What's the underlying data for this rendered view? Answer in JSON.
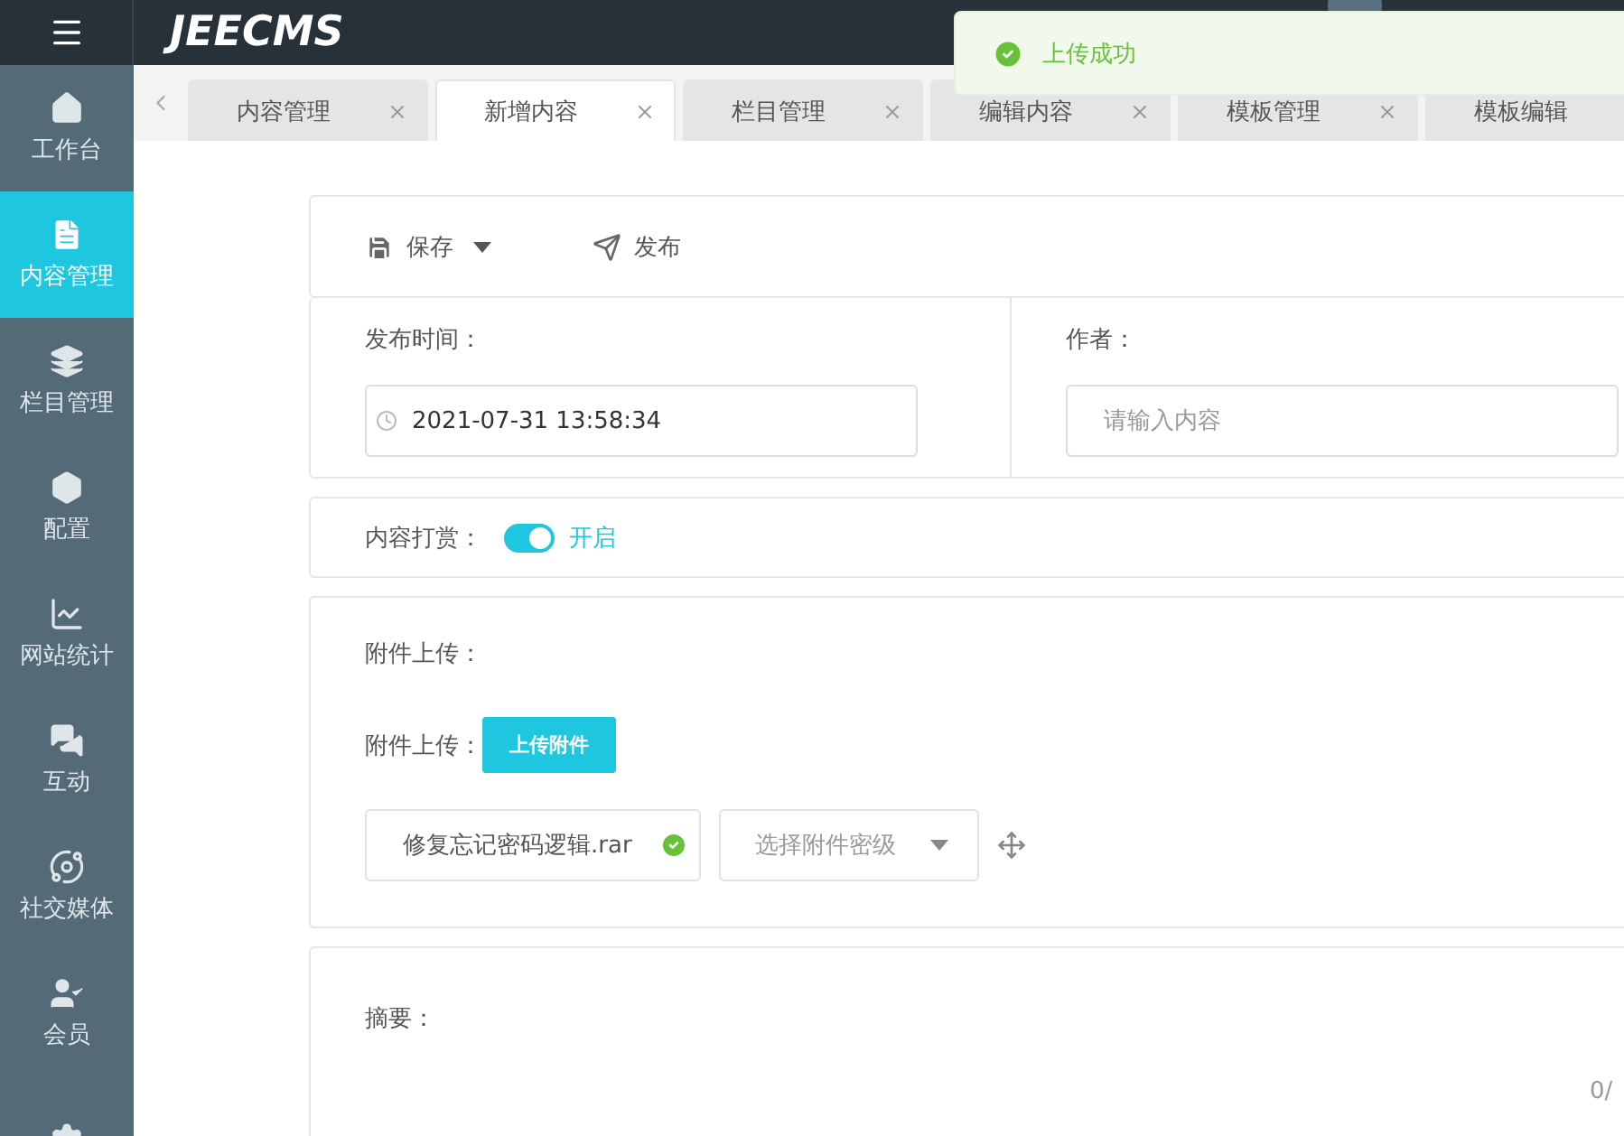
{
  "header": {
    "logo": "JEECMS"
  },
  "toast": {
    "message": "上传成功"
  },
  "sidebar": {
    "items": [
      {
        "kind": "home",
        "label": "工作台",
        "selected": false
      },
      {
        "kind": "doc",
        "label": "内容管理",
        "selected": true
      },
      {
        "kind": "layers",
        "label": "栏目管理",
        "selected": false
      },
      {
        "kind": "box",
        "label": "配置",
        "selected": false
      },
      {
        "kind": "chart",
        "label": "网站统计",
        "selected": false
      },
      {
        "kind": "chat",
        "label": "互动",
        "selected": false
      },
      {
        "kind": "orbit",
        "label": "社交媒体",
        "selected": false
      },
      {
        "kind": "member",
        "label": "会员",
        "selected": false
      },
      {
        "kind": "gear",
        "selected": false
      }
    ]
  },
  "tabs": [
    {
      "label": "内容管理",
      "selected": false
    },
    {
      "label": "新增内容",
      "selected": true
    },
    {
      "label": "栏目管理",
      "selected": false
    },
    {
      "label": "编辑内容",
      "selected": false
    },
    {
      "label": "模板管理",
      "selected": false
    },
    {
      "label": "模板编辑",
      "selected": false
    }
  ],
  "toolbar": {
    "save": "保存",
    "publish": "发布"
  },
  "publish_time": {
    "label": "发布时间：",
    "value": "2021-07-31 13:58:34"
  },
  "author": {
    "label": "作者：",
    "placeholder": "请输入内容"
  },
  "reward": {
    "label": "内容打赏：",
    "on": true,
    "state_text": "开启"
  },
  "attachments": {
    "title": "附件上传：",
    "upload_label": "附件上传：",
    "upload_button": "上传附件",
    "file": {
      "name": "修复忘记密码逻辑.rar",
      "uploaded": true
    },
    "level_select": {
      "placeholder": "选择附件密级"
    }
  },
  "summary": {
    "label": "摘要：",
    "counter": "0/"
  }
}
